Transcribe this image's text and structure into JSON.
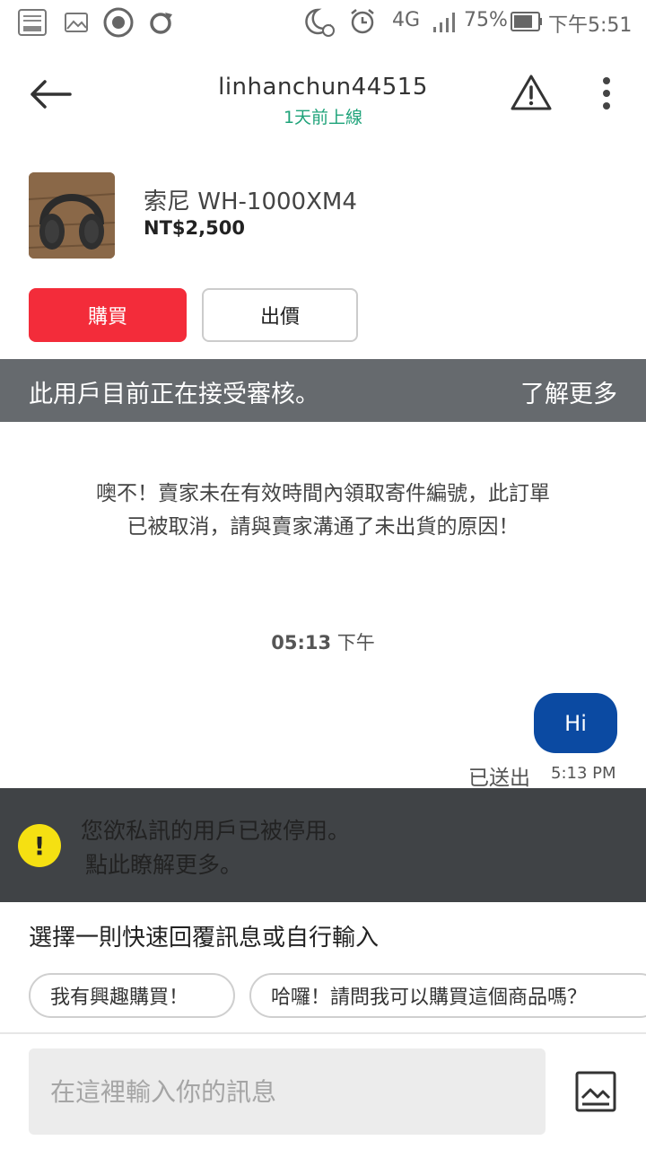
{
  "status_bar": {
    "network": "4G",
    "battery": "75%",
    "time": "下午5:51",
    "icons": [
      "music-player-icon",
      "image-icon",
      "camera-app-icon",
      "sync-icon",
      "do-not-disturb-icon",
      "alarm-icon",
      "signal-icon",
      "battery-icon"
    ]
  },
  "header": {
    "username": "linhanchun44515",
    "last_seen": "1天前上線",
    "icons": [
      "back-arrow-icon",
      "report-warning-icon",
      "more-vertical-icon"
    ]
  },
  "product": {
    "name": "索尼 WH-1000XM4",
    "price": "NT$2,500",
    "buy_label": "購買",
    "offer_label": "出價"
  },
  "review_banner": {
    "text": "此用戶目前正在接受審核。",
    "link": "了解更多"
  },
  "system_message": {
    "line1": "噢不！賣家未在有效時間內領取寄件編號，此訂單",
    "line2": "已被取消，請與賣家溝通了未出貨的原因！"
  },
  "chat": {
    "date_time": "05:13",
    "date_suffix": "下午",
    "messages": [
      {
        "text": "Hi",
        "status": "已送出",
        "time": "5:13 PM"
      }
    ]
  },
  "disabled_notice": {
    "line1": "您欲私訊的用戶已被停用。",
    "line2": "點此瞭解更多。",
    "icon": "warning-icon",
    "icon_color": "#f5e012"
  },
  "quick_replies": {
    "title": "選擇一則快速回覆訊息或自行輸入",
    "chips": [
      "我有興趣購買！",
      "哈囉！請問我可以購買這個商品嗎？"
    ]
  },
  "composer": {
    "placeholder": "在這裡輸入你的訊息",
    "attach_icon": "image-attach-icon"
  },
  "colors": {
    "buy": "#f32c3a",
    "bubble": "#0b4aa2",
    "online": "#1fa37a",
    "review_banner": "#666a6e",
    "notice_banner": "#404346"
  }
}
